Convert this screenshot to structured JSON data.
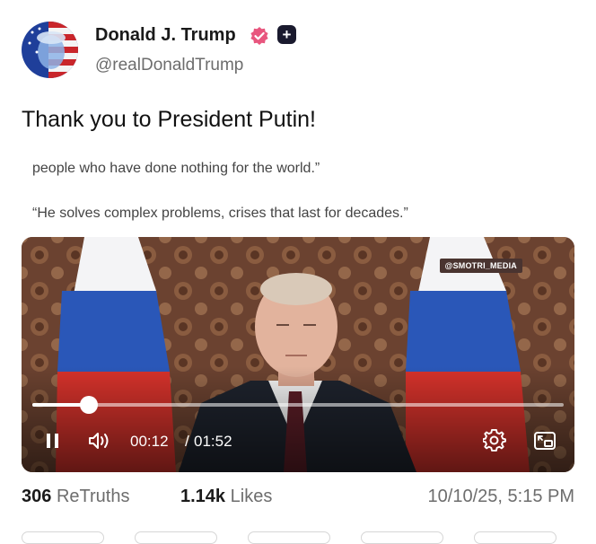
{
  "author": {
    "name": "Donald J. Trump",
    "handle": "@realDonaldTrump",
    "verified_icon": "verified-badge-icon",
    "plus_icon": "plus-icon",
    "avatar_icon": "avatar-flag-portrait"
  },
  "post": {
    "text": "Thank you to President Putin!"
  },
  "quote": {
    "line1": "people who have done nothing for the world.”",
    "line2": "“He solves complex problems, crises that last for decades.”"
  },
  "video": {
    "watermark": "@SMOTRI_MEDIA",
    "time_current": "00:12",
    "time_separator": "/",
    "time_total": "01:52",
    "progress_fraction": 0.1071,
    "icons": {
      "pause": "pause-icon",
      "volume": "volume-icon",
      "settings": "gear-icon",
      "pip": "picture-in-picture-icon"
    }
  },
  "stats": {
    "retruths_count": "306",
    "retruths_label": "ReTruths",
    "likes_count": "1.14k",
    "likes_label": "Likes",
    "timestamp": "10/10/25, 5:15 PM"
  },
  "colors": {
    "verified_badge": "#e8567e",
    "text_primary": "#1a1a1a",
    "text_secondary": "#6d6d6d",
    "flag_blue": "#2a57b8",
    "flag_red": "#d5322b"
  }
}
